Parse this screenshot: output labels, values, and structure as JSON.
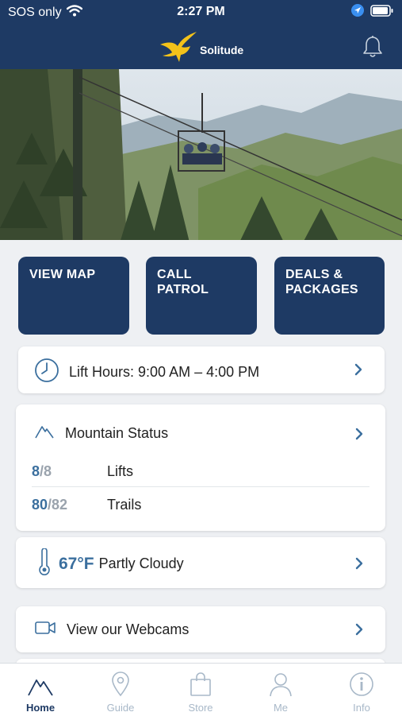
{
  "status_bar": {
    "carrier": "SOS only",
    "time": "2:27 PM"
  },
  "header": {
    "brand": "Solitude"
  },
  "actions": [
    {
      "label": "VIEW MAP"
    },
    {
      "label": "CALL PATROL"
    },
    {
      "label": "DEALS & PACKAGES"
    }
  ],
  "lift_hours": {
    "label": "Lift Hours: 9:00 AM – 4:00 PM"
  },
  "mountain_status": {
    "title": "Mountain Status",
    "lifts": {
      "open": "8",
      "total": "/8",
      "label": "Lifts"
    },
    "trails": {
      "open": "80",
      "total": "/82",
      "label": "Trails"
    }
  },
  "weather": {
    "temp": "67°F",
    "condition": "Partly Cloudy"
  },
  "webcams": {
    "label": "View our Webcams"
  },
  "tabbar": {
    "tabs": [
      {
        "label": "Home",
        "active": true
      },
      {
        "label": "Guide",
        "active": false
      },
      {
        "label": "Store",
        "active": false
      },
      {
        "label": "Me",
        "active": false
      },
      {
        "label": "Info",
        "active": false
      }
    ]
  },
  "colors": {
    "navy": "#1e3a64",
    "accent_blue": "#3b6f9e",
    "tab_inactive": "#a8b8c8",
    "logo_gold": "#f3c21a"
  },
  "icons": {
    "status": [
      "wifi-icon",
      "location-arrow-icon",
      "battery-icon"
    ],
    "header": [
      "solitude-eagle-logo-icon",
      "bell-icon"
    ],
    "rows": [
      "clock-icon",
      "mountain-icon",
      "thermometer-icon",
      "video-camera-icon",
      "chevron-right-icon"
    ],
    "tabs": [
      "home-mountain-icon",
      "guide-pin-icon",
      "store-bag-icon",
      "me-person-icon",
      "info-icon"
    ]
  }
}
